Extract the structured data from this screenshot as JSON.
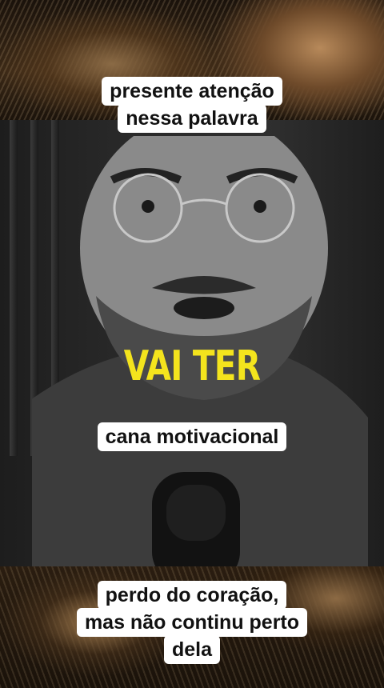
{
  "captions": {
    "top": [
      "presente atenção",
      "nessa palavra"
    ],
    "middle": "cana motivacional",
    "bottom": [
      "perdo do coração,",
      "mas não continu perto",
      "dela"
    ]
  },
  "overlay": {
    "headline": "VAI TER"
  },
  "colors": {
    "headline": "#f4e41d",
    "caption_bg": "#ffffff",
    "caption_text": "#111111"
  }
}
